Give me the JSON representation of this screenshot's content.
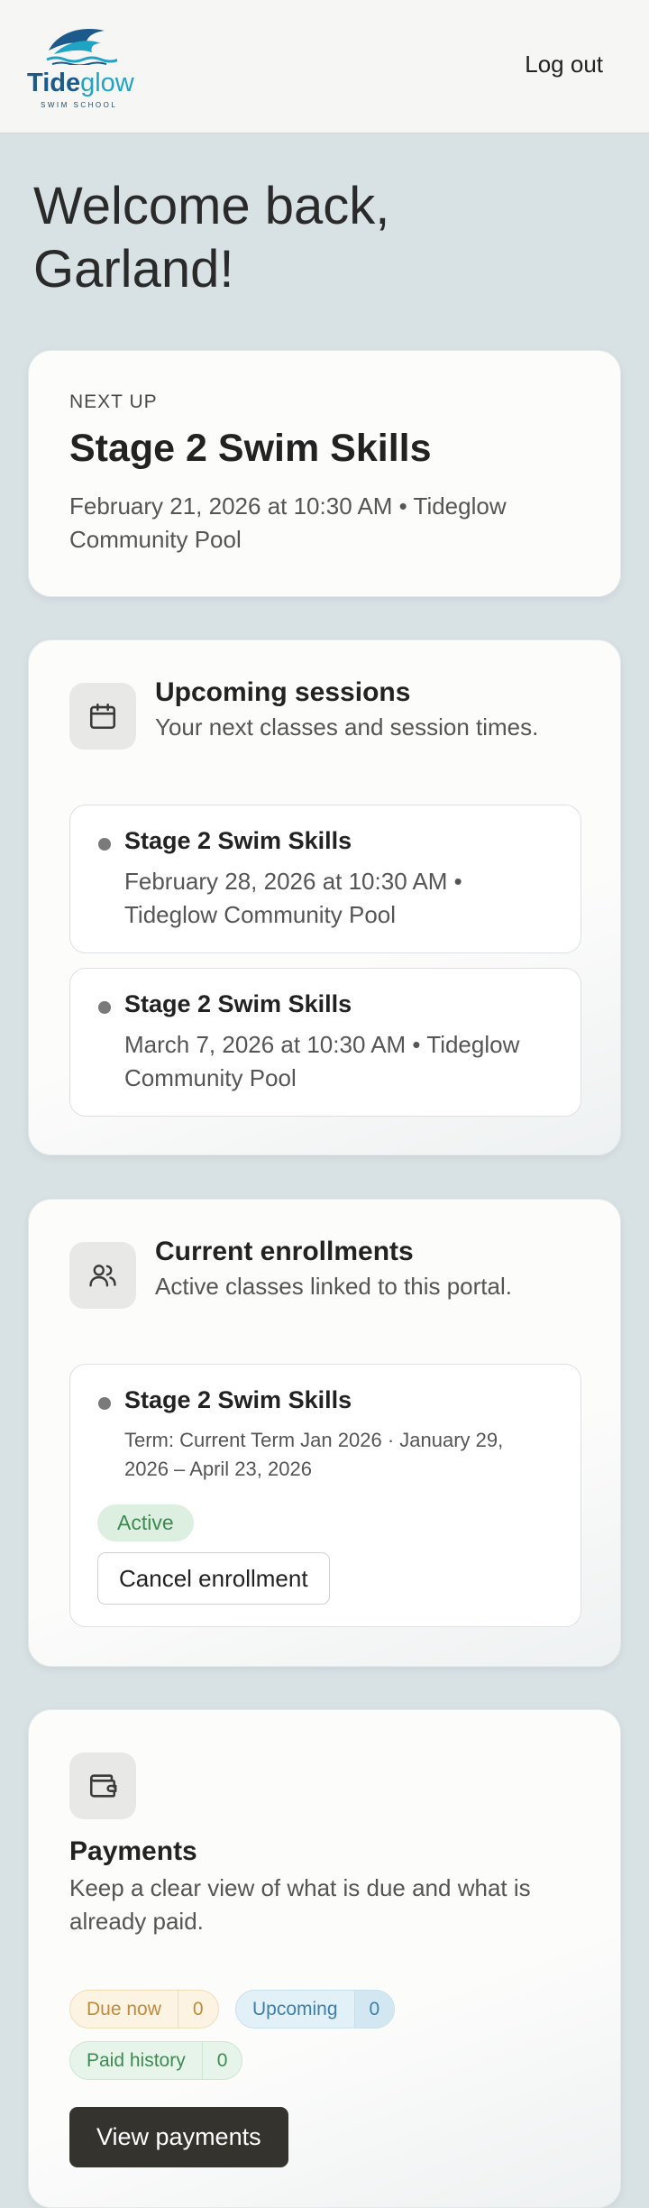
{
  "header": {
    "logo_word_part1": "Tide",
    "logo_word_part2": "glow",
    "logo_subtitle": "SWIM SCHOOL",
    "logout_label": "Log out"
  },
  "welcome": {
    "title": "Welcome back, Garland!"
  },
  "next_up": {
    "eyebrow": "NEXT UP",
    "title": "Stage 2 Swim Skills",
    "detail": "February 21, 2026 at 10:30 AM • Tideglow Community Pool"
  },
  "upcoming": {
    "icon": "calendar-icon",
    "title": "Upcoming sessions",
    "subtitle": "Your next classes and session times.",
    "sessions": [
      {
        "title": "Stage 2 Swim Skills",
        "detail": "February 28, 2026 at 10:30 AM • Tideglow Community Pool"
      },
      {
        "title": "Stage 2 Swim Skills",
        "detail": "March 7, 2026 at 10:30 AM • Tideglow Community Pool"
      }
    ]
  },
  "enrollments": {
    "icon": "users-icon",
    "title": "Current enrollments",
    "subtitle": "Active classes linked to this portal.",
    "items": [
      {
        "title": "Stage 2 Swim Skills",
        "term": "Term: Current Term Jan 2026 · January 29, 2026 – April 23, 2026",
        "status": "Active",
        "cancel_label": "Cancel enrollment"
      }
    ]
  },
  "payments": {
    "icon": "wallet-icon",
    "title": "Payments",
    "subtitle": "Keep a clear view of what is due and what is already paid.",
    "pills": [
      {
        "label": "Due now",
        "count": "0"
      },
      {
        "label": "Upcoming",
        "count": "0"
      },
      {
        "label": "Paid history",
        "count": "0"
      }
    ],
    "view_label": "View payments"
  },
  "colors": {
    "page_bg": "#d8e1e4",
    "header_bg": "#f6f6f5",
    "logo_dark": "#1d5a8c",
    "logo_light": "#20a4c6",
    "primary_button": "#34332d",
    "active_green": "#3f8a52",
    "due_orange": "#c08a3c",
    "upcoming_blue": "#3d7fa8"
  }
}
